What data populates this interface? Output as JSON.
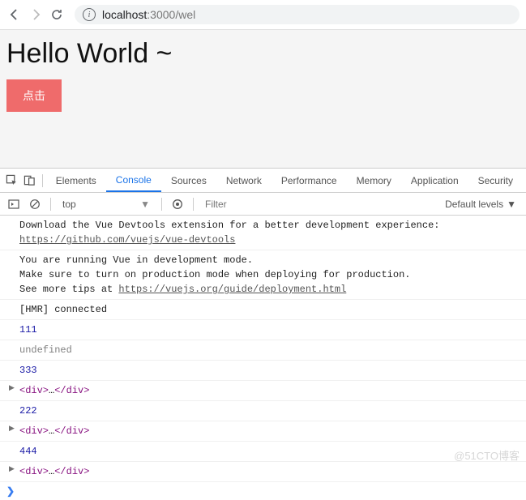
{
  "browser": {
    "url_host": "localhost",
    "url_port": ":3000",
    "url_path": "/wel"
  },
  "page": {
    "title": "Hello World ~",
    "button_label": "点击"
  },
  "devtools": {
    "tabs": [
      "Elements",
      "Console",
      "Sources",
      "Network",
      "Performance",
      "Memory",
      "Application",
      "Security"
    ],
    "active_tab": "Console"
  },
  "console_toolbar": {
    "context": "top",
    "filter_placeholder": "Filter",
    "levels_label": "Default levels"
  },
  "console_messages": [
    {
      "type": "text",
      "text": "Download the Vue Devtools extension for a better development experience:\n",
      "link": "https://github.com/vuejs/vue-devtools"
    },
    {
      "type": "text",
      "text": "You are running Vue in development mode.\nMake sure to turn on production mode when deploying for production.\nSee more tips at ",
      "link": "https://vuejs.org/guide/deployment.html"
    },
    {
      "type": "text",
      "text": "[HMR] connected"
    },
    {
      "type": "num",
      "text": "111"
    },
    {
      "type": "undef",
      "text": "undefined"
    },
    {
      "type": "num",
      "text": "333"
    },
    {
      "type": "element",
      "text": "<div>…</div>"
    },
    {
      "type": "num",
      "text": "222"
    },
    {
      "type": "element",
      "text": "<div>…</div>"
    },
    {
      "type": "num",
      "text": "444"
    },
    {
      "type": "element",
      "text": "<div>…</div>"
    }
  ],
  "watermark": "@51CTO博客"
}
